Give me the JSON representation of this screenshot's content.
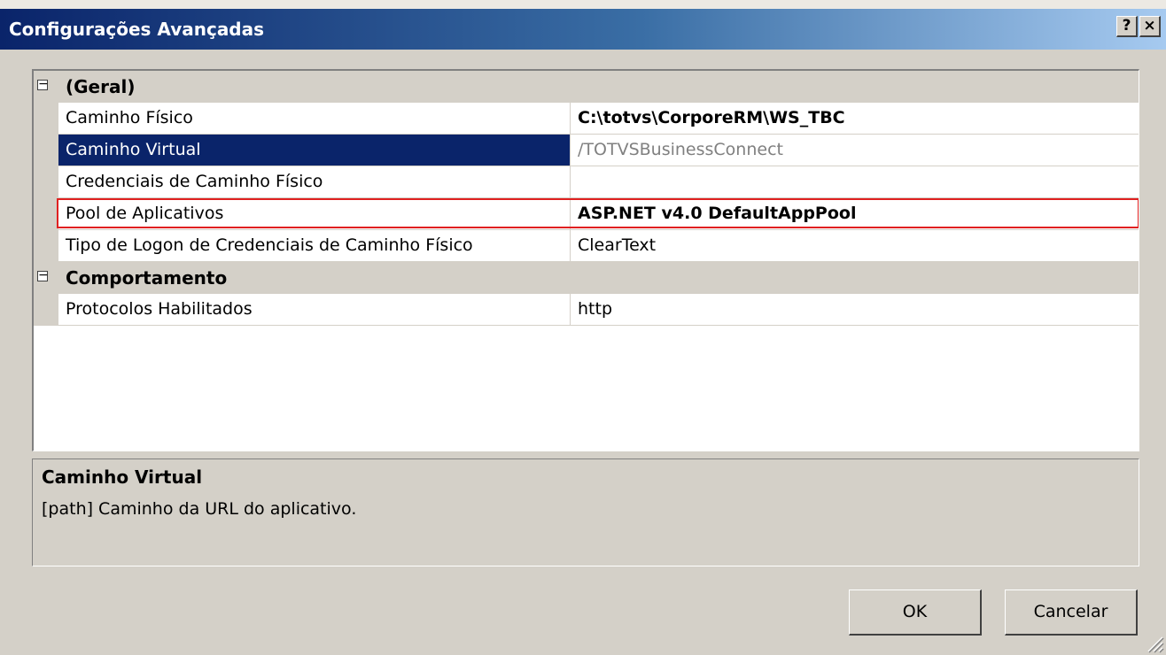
{
  "window": {
    "title": "Configurações Avançadas",
    "help_label": "?",
    "close_label": "×"
  },
  "grid": {
    "categories": [
      {
        "toggle": "−",
        "label": "(Geral)",
        "rows": [
          {
            "name": "Caminho Físico",
            "value": "C:\\totvs\\CorporeRM\\WS_TBC"
          },
          {
            "name": "Caminho Virtual",
            "value": "/TOTVSBusinessConnect"
          },
          {
            "name": "Credenciais de Caminho Físico",
            "value": ""
          },
          {
            "name": "Pool de Aplicativos",
            "value": "ASP.NET v4.0 DefaultAppPool"
          },
          {
            "name": "Tipo de Logon de Credenciais de Caminho Físico",
            "value": "ClearText"
          }
        ]
      },
      {
        "toggle": "−",
        "label": "Comportamento",
        "rows": [
          {
            "name": "Protocolos Habilitados",
            "value": "http"
          }
        ]
      }
    ],
    "selected_row": "Caminho Virtual",
    "highlight_color": "#e02020",
    "selection_color": "#0a246a"
  },
  "description": {
    "title": "Caminho Virtual",
    "text": "[path] Caminho da URL do aplicativo."
  },
  "buttons": {
    "ok_label": "OK",
    "cancel_label": "Cancelar"
  }
}
